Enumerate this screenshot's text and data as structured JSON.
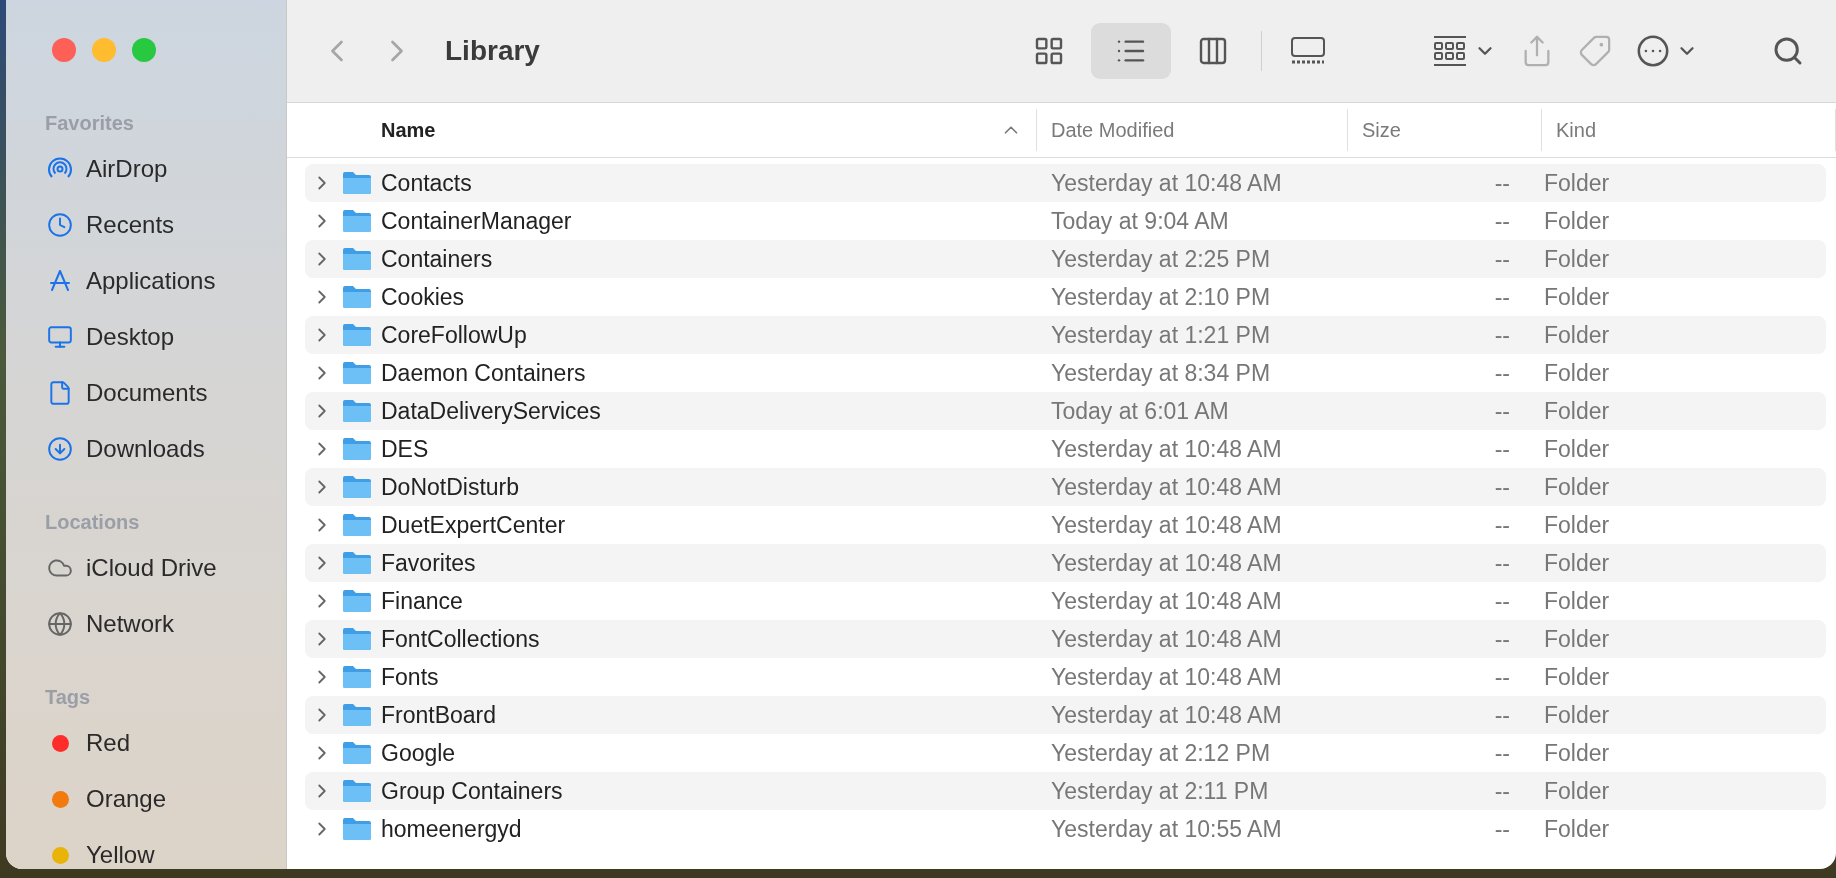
{
  "window": {
    "title": "Library"
  },
  "sidebar": {
    "sections": [
      {
        "heading": "Favorites",
        "items": [
          {
            "label": "AirDrop",
            "kind": "airdrop"
          },
          {
            "label": "Recents",
            "kind": "recents"
          },
          {
            "label": "Applications",
            "kind": "applications"
          },
          {
            "label": "Desktop",
            "kind": "desktop"
          },
          {
            "label": "Documents",
            "kind": "documents"
          },
          {
            "label": "Downloads",
            "kind": "downloads"
          }
        ]
      },
      {
        "heading": "Locations",
        "items": [
          {
            "label": "iCloud Drive",
            "kind": "cloud"
          },
          {
            "label": "Network",
            "kind": "network"
          }
        ]
      },
      {
        "heading": "Tags",
        "items": [
          {
            "label": "Red",
            "kind": "tag",
            "color": "#fe2d2a"
          },
          {
            "label": "Orange",
            "kind": "tag",
            "color": "#f27a0e"
          },
          {
            "label": "Yellow",
            "kind": "tag",
            "color": "#eab308"
          }
        ]
      }
    ]
  },
  "toolbar": {
    "view_modes": [
      {
        "kind": "icons",
        "selected": false
      },
      {
        "kind": "list",
        "selected": true
      },
      {
        "kind": "columns",
        "selected": false
      },
      {
        "kind": "gallery",
        "selected": false
      }
    ]
  },
  "table": {
    "columns": [
      {
        "label": "Name",
        "sorted": true
      },
      {
        "label": "Date Modified",
        "sorted": false
      },
      {
        "label": "Size",
        "sorted": false
      },
      {
        "label": "Kind",
        "sorted": false
      }
    ],
    "rows": [
      {
        "name": "Contacts",
        "date": "Yesterday at 10:48 AM",
        "size": "--",
        "kind": "Folder"
      },
      {
        "name": "ContainerManager",
        "date": "Today at 9:04 AM",
        "size": "--",
        "kind": "Folder"
      },
      {
        "name": "Containers",
        "date": "Yesterday at 2:25 PM",
        "size": "--",
        "kind": "Folder"
      },
      {
        "name": "Cookies",
        "date": "Yesterday at 2:10 PM",
        "size": "--",
        "kind": "Folder"
      },
      {
        "name": "CoreFollowUp",
        "date": "Yesterday at 1:21 PM",
        "size": "--",
        "kind": "Folder"
      },
      {
        "name": "Daemon Containers",
        "date": "Yesterday at 8:34 PM",
        "size": "--",
        "kind": "Folder"
      },
      {
        "name": "DataDeliveryServices",
        "date": "Today at 6:01 AM",
        "size": "--",
        "kind": "Folder"
      },
      {
        "name": "DES",
        "date": "Yesterday at 10:48 AM",
        "size": "--",
        "kind": "Folder"
      },
      {
        "name": "DoNotDisturb",
        "date": "Yesterday at 10:48 AM",
        "size": "--",
        "kind": "Folder"
      },
      {
        "name": "DuetExpertCenter",
        "date": "Yesterday at 10:48 AM",
        "size": "--",
        "kind": "Folder"
      },
      {
        "name": "Favorites",
        "date": "Yesterday at 10:48 AM",
        "size": "--",
        "kind": "Folder"
      },
      {
        "name": "Finance",
        "date": "Yesterday at 10:48 AM",
        "size": "--",
        "kind": "Folder"
      },
      {
        "name": "FontCollections",
        "date": "Yesterday at 10:48 AM",
        "size": "--",
        "kind": "Folder"
      },
      {
        "name": "Fonts",
        "date": "Yesterday at 10:48 AM",
        "size": "--",
        "kind": "Folder"
      },
      {
        "name": "FrontBoard",
        "date": "Yesterday at 10:48 AM",
        "size": "--",
        "kind": "Folder"
      },
      {
        "name": "Google",
        "date": "Yesterday at 2:12 PM",
        "size": "--",
        "kind": "Folder"
      },
      {
        "name": "Group Containers",
        "date": "Yesterday at 2:11 PM",
        "size": "--",
        "kind": "Folder"
      },
      {
        "name": "homeenergyd",
        "date": "Yesterday at 10:55 AM",
        "size": "--",
        "kind": "Folder"
      }
    ]
  }
}
